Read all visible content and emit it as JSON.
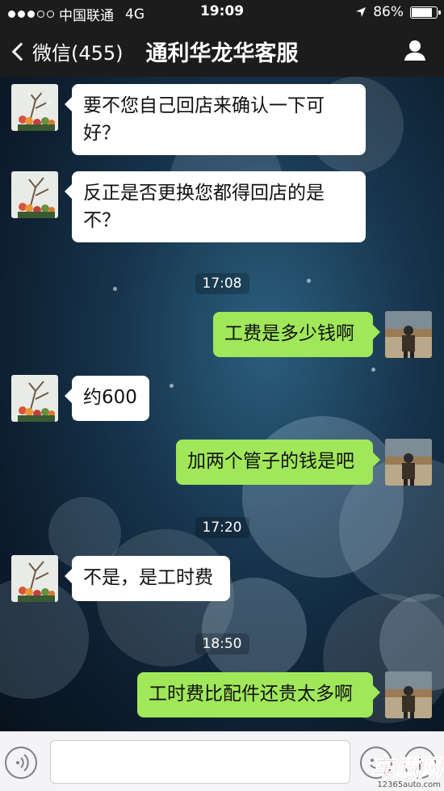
{
  "status_bar": {
    "carrier": "中国联通",
    "network": "4G",
    "time": "19:09",
    "battery": "86%",
    "battery_level": 0.86
  },
  "nav": {
    "back_label": "微信(455)",
    "title": "通利华龙华客服"
  },
  "messages": [
    {
      "side": "left",
      "text": "要不您自己回店来确认一下可好？"
    },
    {
      "side": "left",
      "text": "反正是否更换您都得回店的是不？"
    },
    {
      "type": "time",
      "text": "17:08"
    },
    {
      "side": "right",
      "text": "工费是多少钱啊"
    },
    {
      "side": "left",
      "text": "约600"
    },
    {
      "side": "right",
      "text": "加两个管子的钱是吧"
    },
    {
      "type": "time",
      "text": "17:20"
    },
    {
      "side": "left",
      "text": "不是，是工时费"
    },
    {
      "type": "time",
      "text": "18:50"
    },
    {
      "side": "right",
      "text": "工时费比配件还贵太多啊"
    }
  ],
  "input_bar": {
    "input_value": "",
    "voice_icon": "voice-icon",
    "emoji_icon": "emoji-icon",
    "plus_icon": "plus-icon"
  },
  "watermark": {
    "logo": "车质网",
    "url": "12365auto.com"
  },
  "colors": {
    "bar_bg": "#1c1c1c",
    "bubble_sent": "#a0e75a",
    "bubble_received": "#ffffff"
  }
}
